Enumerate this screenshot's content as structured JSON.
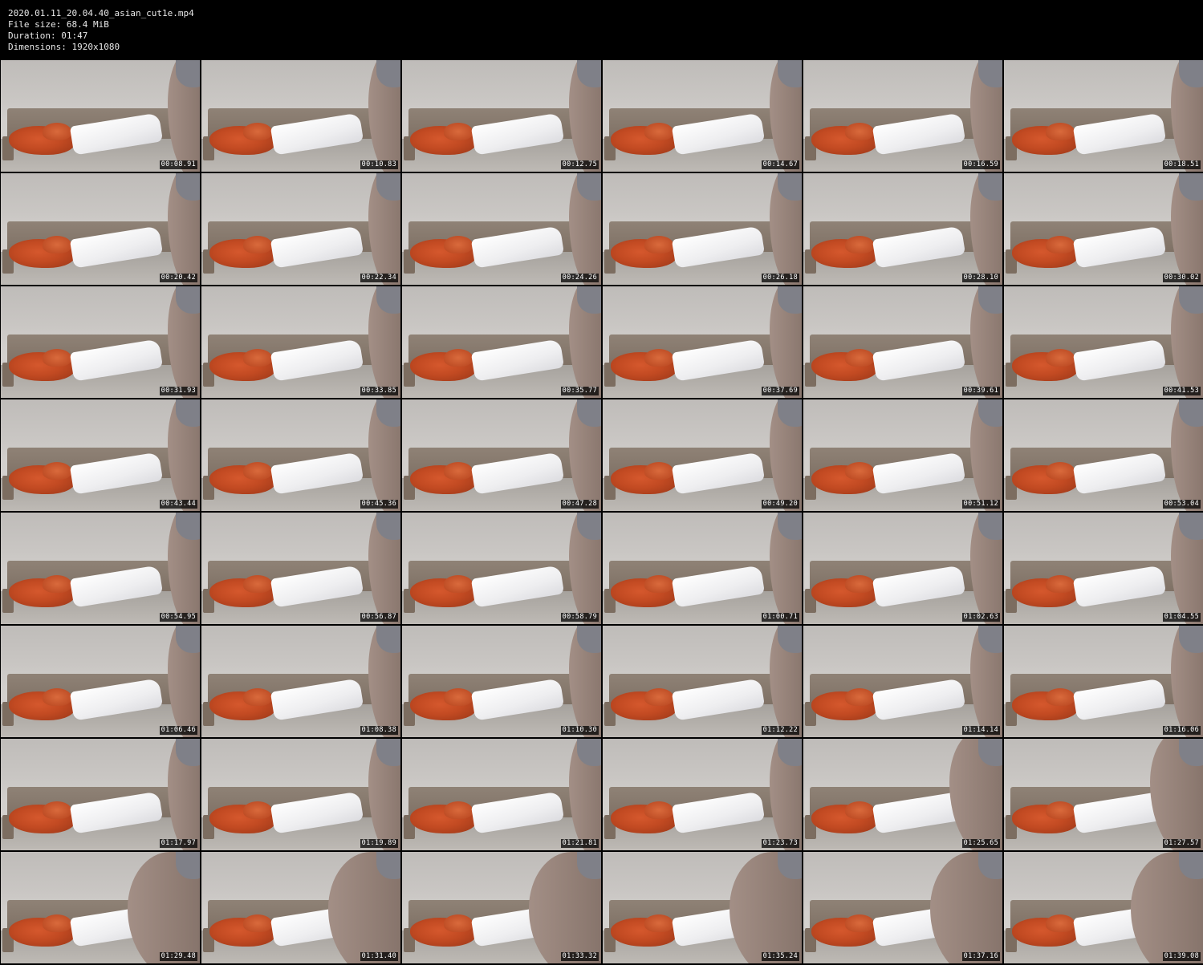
{
  "header": {
    "filename": "2020.01.11_20.04.40_asian_cut1e.mp4",
    "file_size": "File size: 68.4 MiB",
    "duration": "Duration: 01:47",
    "dimensions": "Dimensions: 1920x1080"
  },
  "thumbnails": [
    "00:08.91",
    "00:10.83",
    "00:12.75",
    "00:14.67",
    "00:16.59",
    "00:18.51",
    "00:20.42",
    "00:22.34",
    "00:24.26",
    "00:26.18",
    "00:28.10",
    "00:30.02",
    "00:31.93",
    "00:33.85",
    "00:35.77",
    "00:37.69",
    "00:39.61",
    "00:41.53",
    "00:43.44",
    "00:45.36",
    "00:47.28",
    "00:49.20",
    "00:51.12",
    "00:53.04",
    "00:54.95",
    "00:56.87",
    "00:58.79",
    "01:00.71",
    "01:02.63",
    "01:04.55",
    "01:06.46",
    "01:08.38",
    "01:10.30",
    "01:12.22",
    "01:14.14",
    "01:16.06",
    "01:17.97",
    "01:19.89",
    "01:21.81",
    "01:23.73",
    "01:25.65",
    "01:27.57",
    "01:29.48",
    "01:31.40",
    "01:33.32",
    "01:35.24",
    "01:37.16",
    "01:39.08"
  ]
}
